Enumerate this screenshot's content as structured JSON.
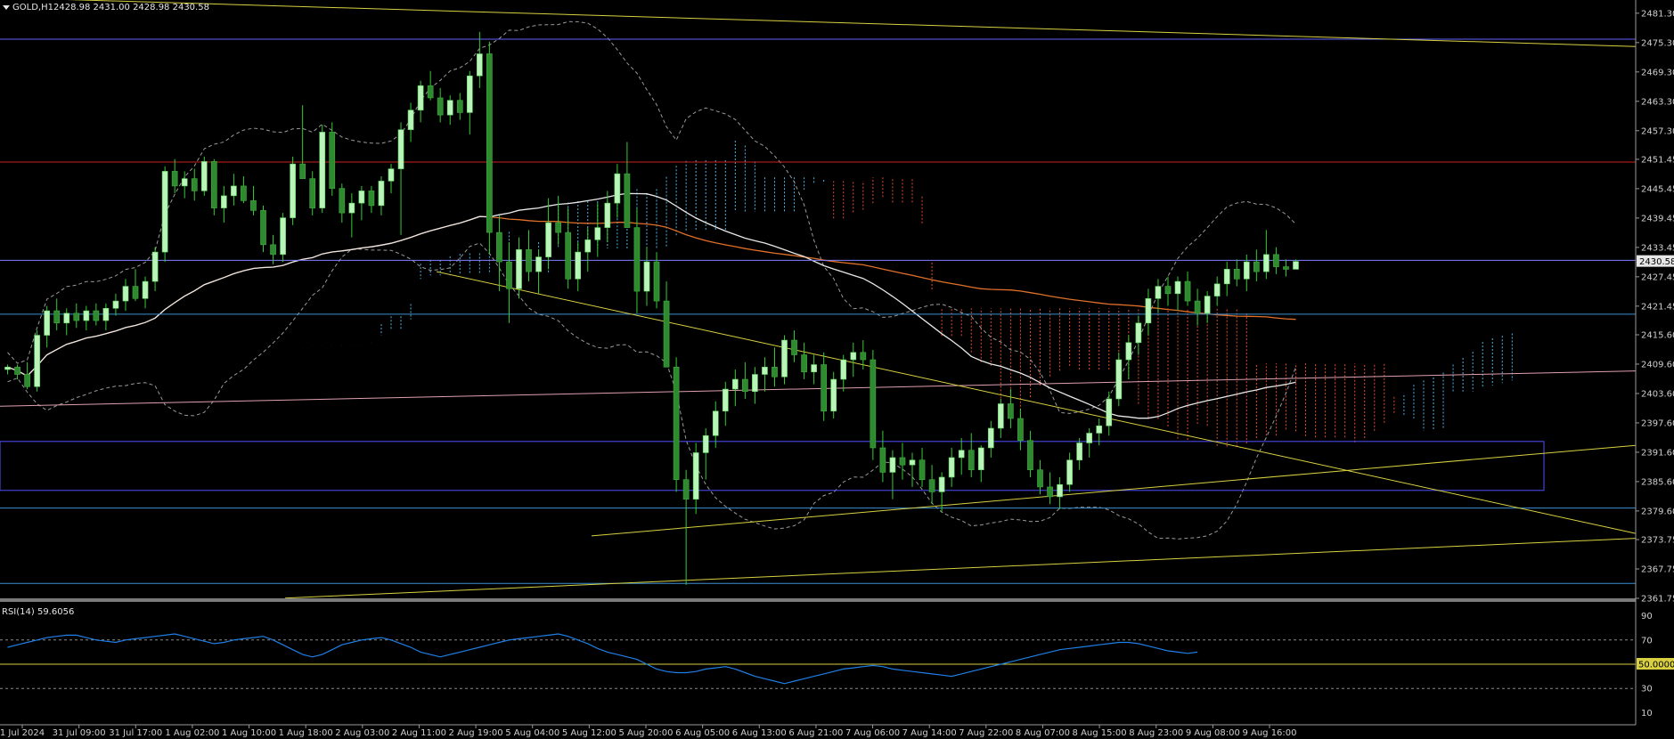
{
  "header": {
    "symbol_label": "GOLD,H1",
    "ohlc_text": "2428.98 2431.00 2428.98 2430.58"
  },
  "rsi_panel": {
    "label": "RSI(14) 59.6056"
  },
  "price_axis": {
    "ticks": [
      "2481.30",
      "2475.30",
      "2469.30",
      "2463.30",
      "2457.30",
      "2451.45",
      "2445.45",
      "2439.45",
      "2433.45",
      "2427.45",
      "2421.45",
      "2415.60",
      "2409.60",
      "2403.60",
      "2397.60",
      "2391.60",
      "2385.60",
      "2379.60",
      "2373.75",
      "2367.75",
      "2361.75"
    ],
    "current_price_tag": "2430.58"
  },
  "rsi_axis": {
    "ticks": [
      "90",
      "70",
      "30",
      "10"
    ],
    "level_tag": "50.0000"
  },
  "time_axis": {
    "labels": [
      "1 Jul 2024",
      "31 Jul 09:00",
      "31 Jul 17:00",
      "1 Aug 02:00",
      "1 Aug 10:00",
      "1 Aug 18:00",
      "2 Aug 03:00",
      "2 Aug 11:00",
      "2 Aug 19:00",
      "5 Aug 04:00",
      "5 Aug 12:00",
      "5 Aug 20:00",
      "6 Aug 05:00",
      "6 Aug 13:00",
      "6 Aug 21:00",
      "7 Aug 06:00",
      "7 Aug 14:00",
      "7 Aug 22:00",
      "8 Aug 07:00",
      "8 Aug 15:00",
      "8 Aug 23:00",
      "9 Aug 08:00",
      "9 Aug 16:00"
    ]
  },
  "colors": {
    "background": "#000000",
    "bull_candle": "#b9f5b9",
    "bear_candle": "#2f8a2f",
    "wick": "#33cc33",
    "bollinger": "#9a9a9a",
    "ma_slow": "#e8e8e8",
    "ma_fast": "#e0702a",
    "kumo_bull": "#59c9ff",
    "kumo_bear": "#ff5533",
    "trendline": "#d8d040",
    "horizontal_blue": "#6262ff",
    "horizontal_red": "#d02020",
    "horizontal_pink": "#e0a0b0",
    "horizontal_steel": "#3c8fd0",
    "box_border": "#5050ff",
    "rsi_line": "#1f7fe6",
    "rsi_level_50": "#d8d040",
    "axis_text": "#cfcfcf"
  },
  "chart_data": {
    "type": "candlestick",
    "symbol": "GOLD",
    "timeframe": "H1",
    "ylim": [
      2361.75,
      2484.0
    ],
    "candles": [
      [
        2408.5,
        2409.5,
        2407.5,
        2409.0
      ],
      [
        2409.0,
        2409.5,
        2406.5,
        2407.5
      ],
      [
        2407.5,
        2410.0,
        2404.5,
        2405.0
      ],
      [
        2405.0,
        2416.5,
        2404.0,
        2415.5
      ],
      [
        2415.5,
        2421.5,
        2413.0,
        2420.5
      ],
      [
        2420.5,
        2423.0,
        2416.5,
        2418.0
      ],
      [
        2418.0,
        2421.0,
        2415.5,
        2420.0
      ],
      [
        2420.0,
        2422.0,
        2417.0,
        2418.5
      ],
      [
        2418.5,
        2421.5,
        2416.5,
        2420.5
      ],
      [
        2420.5,
        2422.0,
        2417.5,
        2418.5
      ],
      [
        2418.5,
        2422.0,
        2416.5,
        2421.0
      ],
      [
        2421.0,
        2424.0,
        2419.5,
        2422.5
      ],
      [
        2422.5,
        2427.0,
        2420.5,
        2425.5
      ],
      [
        2425.5,
        2429.0,
        2422.5,
        2423.0
      ],
      [
        2423.0,
        2427.5,
        2421.0,
        2426.5
      ],
      [
        2426.5,
        2433.5,
        2424.5,
        2432.5
      ],
      [
        2432.5,
        2450.0,
        2430.5,
        2449.0
      ],
      [
        2449.0,
        2451.5,
        2444.5,
        2446.0
      ],
      [
        2446.0,
        2449.0,
        2443.5,
        2447.5
      ],
      [
        2447.5,
        2449.5,
        2443.0,
        2445.0
      ],
      [
        2445.0,
        2452.0,
        2444.0,
        2451.0
      ],
      [
        2451.0,
        2451.5,
        2440.0,
        2441.5
      ],
      [
        2441.5,
        2446.0,
        2438.5,
        2444.0
      ],
      [
        2444.0,
        2448.5,
        2442.0,
        2446.0
      ],
      [
        2446.0,
        2448.0,
        2442.5,
        2443.0
      ],
      [
        2443.0,
        2446.0,
        2440.0,
        2441.0
      ],
      [
        2441.0,
        2442.0,
        2432.5,
        2434.0
      ],
      [
        2434.0,
        2436.0,
        2430.0,
        2432.0
      ],
      [
        2432.0,
        2440.5,
        2430.5,
        2439.5
      ],
      [
        2439.5,
        2452.0,
        2438.0,
        2450.5
      ],
      [
        2450.5,
        2462.5,
        2448.0,
        2447.5
      ],
      [
        2447.5,
        2449.0,
        2440.0,
        2441.5
      ],
      [
        2441.5,
        2458.5,
        2440.5,
        2457.0
      ],
      [
        2457.0,
        2459.0,
        2444.0,
        2445.5
      ],
      [
        2445.5,
        2446.5,
        2438.5,
        2440.5
      ],
      [
        2440.5,
        2444.5,
        2435.5,
        2442.5
      ],
      [
        2442.5,
        2446.0,
        2439.0,
        2445.0
      ],
      [
        2445.0,
        2446.0,
        2440.5,
        2442.0
      ],
      [
        2442.0,
        2448.0,
        2440.0,
        2447.0
      ],
      [
        2447.0,
        2450.5,
        2444.5,
        2449.5
      ],
      [
        2449.5,
        2459.0,
        2436.0,
        2457.5
      ],
      [
        2457.5,
        2463.0,
        2455.0,
        2461.5
      ],
      [
        2461.5,
        2467.5,
        2459.0,
        2466.5
      ],
      [
        2466.5,
        2469.5,
        2463.5,
        2464.0
      ],
      [
        2464.0,
        2466.0,
        2459.0,
        2460.5
      ],
      [
        2460.5,
        2464.5,
        2458.5,
        2463.5
      ],
      [
        2463.5,
        2465.0,
        2459.5,
        2461.0
      ],
      [
        2461.0,
        2469.5,
        2456.5,
        2468.5
      ],
      [
        2468.5,
        2477.5,
        2466.0,
        2473.0
      ],
      [
        2473.0,
        2475.5,
        2432.0,
        2436.5
      ],
      [
        2436.5,
        2440.0,
        2424.5,
        2430.5
      ],
      [
        2430.5,
        2434.5,
        2418.0,
        2425.0
      ],
      [
        2425.0,
        2435.5,
        2423.0,
        2433.0
      ],
      [
        2433.0,
        2437.0,
        2426.5,
        2428.5
      ],
      [
        2428.5,
        2433.0,
        2424.0,
        2431.5
      ],
      [
        2431.5,
        2443.5,
        2429.0,
        2438.5
      ],
      [
        2438.5,
        2444.0,
        2434.0,
        2436.5
      ],
      [
        2436.5,
        2441.5,
        2425.0,
        2427.0
      ],
      [
        2427.0,
        2434.5,
        2424.5,
        2432.5
      ],
      [
        2432.5,
        2437.5,
        2428.5,
        2435.0
      ],
      [
        2435.0,
        2442.5,
        2431.5,
        2437.5
      ],
      [
        2437.5,
        2445.0,
        2434.5,
        2442.5
      ],
      [
        2442.5,
        2450.5,
        2439.5,
        2448.5
      ],
      [
        2448.5,
        2455.0,
        2445.5,
        2437.5
      ],
      [
        2437.5,
        2441.5,
        2420.0,
        2424.5
      ],
      [
        2424.5,
        2433.5,
        2421.5,
        2430.5
      ],
      [
        2430.5,
        2432.5,
        2421.0,
        2422.5
      ],
      [
        2422.5,
        2426.5,
        2410.5,
        2409.0
      ],
      [
        2409.0,
        2411.0,
        2383.5,
        2386.0
      ],
      [
        2386.0,
        2388.0,
        2364.5,
        2382.0
      ],
      [
        2382.0,
        2393.5,
        2379.0,
        2391.5
      ],
      [
        2391.5,
        2396.5,
        2386.0,
        2395.0
      ],
      [
        2395.0,
        2402.0,
        2392.5,
        2400.0
      ],
      [
        2400.0,
        2406.0,
        2397.0,
        2404.5
      ],
      [
        2404.5,
        2408.5,
        2401.0,
        2406.5
      ],
      [
        2406.5,
        2410.0,
        2402.5,
        2404.0
      ],
      [
        2404.0,
        2409.0,
        2401.5,
        2407.5
      ],
      [
        2407.5,
        2411.0,
        2404.0,
        2409.0
      ],
      [
        2409.0,
        2413.0,
        2405.0,
        2407.0
      ],
      [
        2407.0,
        2415.5,
        2405.5,
        2414.5
      ],
      [
        2414.5,
        2416.5,
        2410.0,
        2411.5
      ],
      [
        2411.5,
        2414.0,
        2406.5,
        2408.0
      ],
      [
        2408.0,
        2411.5,
        2405.5,
        2409.5
      ],
      [
        2409.5,
        2412.0,
        2398.0,
        2400.0
      ],
      [
        2400.0,
        2408.0,
        2398.5,
        2406.5
      ],
      [
        2406.5,
        2411.5,
        2404.0,
        2410.5
      ],
      [
        2410.5,
        2414.0,
        2407.0,
        2412.0
      ],
      [
        2412.0,
        2414.5,
        2408.5,
        2410.5
      ],
      [
        2410.5,
        2412.5,
        2390.0,
        2392.5
      ],
      [
        2392.5,
        2396.0,
        2385.5,
        2387.5
      ],
      [
        2387.5,
        2392.0,
        2382.0,
        2390.5
      ],
      [
        2390.5,
        2393.5,
        2386.0,
        2389.0
      ],
      [
        2389.0,
        2391.5,
        2384.5,
        2390.0
      ],
      [
        2390.0,
        2392.5,
        2384.5,
        2386.0
      ],
      [
        2386.0,
        2389.0,
        2381.0,
        2383.5
      ],
      [
        2383.5,
        2387.5,
        2379.5,
        2386.5
      ],
      [
        2386.5,
        2392.5,
        2384.5,
        2390.5
      ],
      [
        2390.5,
        2394.5,
        2387.0,
        2392.0
      ],
      [
        2392.0,
        2395.5,
        2386.5,
        2388.0
      ],
      [
        2388.0,
        2393.0,
        2385.5,
        2392.5
      ],
      [
        2392.5,
        2398.0,
        2390.5,
        2396.5
      ],
      [
        2396.5,
        2402.5,
        2394.5,
        2401.5
      ],
      [
        2401.5,
        2404.5,
        2396.5,
        2398.5
      ],
      [
        2398.5,
        2400.5,
        2392.0,
        2394.0
      ],
      [
        2394.0,
        2396.0,
        2386.5,
        2388.0
      ],
      [
        2388.0,
        2390.0,
        2383.0,
        2384.5
      ],
      [
        2384.5,
        2387.5,
        2381.0,
        2382.5
      ],
      [
        2382.5,
        2386.5,
        2380.0,
        2385.0
      ],
      [
        2385.0,
        2391.5,
        2383.5,
        2390.0
      ],
      [
        2390.0,
        2394.5,
        2388.0,
        2393.5
      ],
      [
        2393.5,
        2396.5,
        2390.5,
        2395.5
      ],
      [
        2395.5,
        2398.5,
        2393.0,
        2397.0
      ],
      [
        2397.0,
        2404.0,
        2395.0,
        2402.5
      ],
      [
        2402.5,
        2412.0,
        2401.0,
        2410.5
      ],
      [
        2410.5,
        2415.5,
        2406.5,
        2414.0
      ],
      [
        2414.0,
        2419.5,
        2411.5,
        2418.0
      ],
      [
        2418.0,
        2425.0,
        2415.5,
        2423.0
      ],
      [
        2423.0,
        2427.0,
        2420.0,
        2425.5
      ],
      [
        2425.5,
        2427.5,
        2421.5,
        2424.0
      ],
      [
        2424.0,
        2427.5,
        2420.5,
        2426.5
      ],
      [
        2426.5,
        2428.5,
        2421.5,
        2422.5
      ],
      [
        2422.5,
        2425.0,
        2417.5,
        2420.0
      ],
      [
        2420.0,
        2424.5,
        2418.0,
        2423.5
      ],
      [
        2423.5,
        2427.5,
        2421.5,
        2426.0
      ],
      [
        2426.0,
        2430.5,
        2423.5,
        2429.0
      ],
      [
        2429.0,
        2431.0,
        2425.5,
        2427.0
      ],
      [
        2427.0,
        2432.0,
        2424.5,
        2430.5
      ],
      [
        2430.5,
        2433.0,
        2426.5,
        2428.5
      ],
      [
        2428.5,
        2437.0,
        2427.0,
        2432.0
      ],
      [
        2432.0,
        2433.5,
        2428.0,
        2429.5
      ],
      [
        2429.5,
        2431.0,
        2427.5,
        2428.98
      ],
      [
        2428.98,
        2431.0,
        2428.98,
        2430.58
      ]
    ],
    "series": [
      {
        "name": "RSI(14)",
        "values": [
          64,
          66,
          68,
          70,
          72,
          73,
          74,
          74,
          72,
          70,
          69,
          68,
          70,
          71,
          72,
          73,
          74,
          75,
          73,
          71,
          69,
          67,
          68,
          70,
          71,
          72,
          73,
          70,
          66,
          62,
          58,
          56,
          58,
          62,
          66,
          68,
          70,
          71,
          72,
          70,
          67,
          64,
          60,
          58,
          56,
          58,
          60,
          62,
          64,
          66,
          68,
          70,
          71,
          72,
          73,
          74,
          75,
          73,
          70,
          67,
          63,
          60,
          58,
          56,
          54,
          50,
          46,
          44,
          43,
          43,
          44,
          46,
          47,
          48,
          46,
          43,
          40,
          38,
          36,
          34,
          36,
          38,
          40,
          42,
          44,
          46,
          47,
          48,
          49,
          48,
          46,
          45,
          44,
          43,
          42,
          41,
          40,
          42,
          44,
          46,
          48,
          50,
          52,
          54,
          56,
          58,
          60,
          62,
          63,
          64,
          65,
          66,
          67,
          68,
          68,
          67,
          65,
          63,
          61,
          60,
          59,
          60
        ]
      }
    ],
    "rsi_ylim": [
      0,
      100
    ],
    "rsi_level": 50.0
  }
}
